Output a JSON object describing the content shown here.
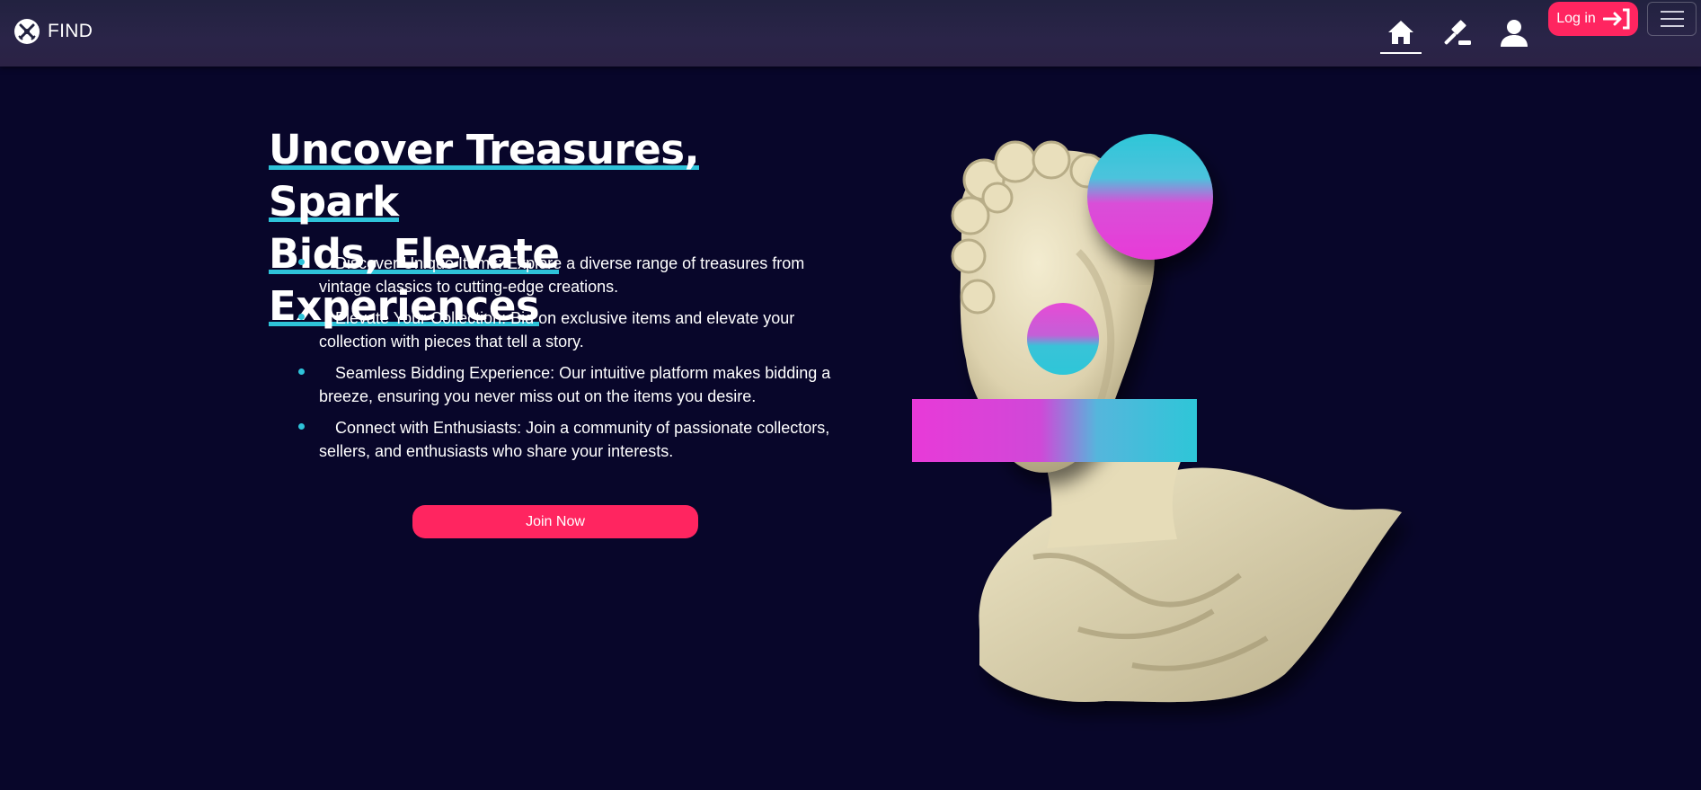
{
  "header": {
    "brand": "FIND",
    "login_label": "Log in"
  },
  "hero": {
    "title_parts": [
      "Uncover Treasures, Spark",
      "Bids, Elevate Experiences"
    ],
    "features": [
      "Discover Unique Items: Explore a diverse range of treasures from vintage classics to cutting-edge creations.",
      "Elevate Your Collection: Bid on exclusive items and elevate your collection with pieces that tell a story.",
      "Seamless Bidding Experience: Our intuitive platform makes bidding a breeze, ensuring you never miss out on the items you desire.",
      "Connect with Enthusiasts: Join a community of passionate collectors, sellers, and enthusiasts who share your interests."
    ],
    "cta_label": "Join Now"
  },
  "colors": {
    "background": "#08062a",
    "accent_pink": "#ff2560",
    "accent_cyan": "#2ec3d9",
    "art_magenta": "#e83ad8"
  },
  "icons": [
    "find-logo-icon",
    "home-icon",
    "gavel-icon",
    "user-icon",
    "login-arrow-icon",
    "hamburger-icon"
  ]
}
